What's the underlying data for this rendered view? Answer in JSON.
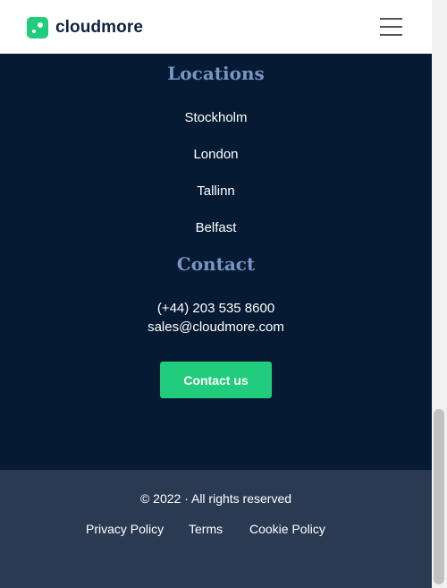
{
  "header": {
    "logo_text": "cloudmore",
    "menu_icon": "hamburger-menu-icon"
  },
  "locations": {
    "heading": "Locations",
    "items": [
      "Stockholm",
      "London",
      "Tallinn",
      "Belfast"
    ]
  },
  "contact": {
    "heading": "Contact",
    "phone": "(+44) 203 535 8600",
    "email": "sales@cloudmore.com",
    "button_label": "Contact us"
  },
  "footer": {
    "copyright": "© 2022 · All rights reserved",
    "links": [
      "Privacy Policy",
      "Terms",
      "Cookie Policy"
    ]
  },
  "colors": {
    "dark_bg": "#061b33",
    "footer_bg": "#2b3a53",
    "accent": "#22cc7d",
    "heading": "#7b95c3"
  }
}
